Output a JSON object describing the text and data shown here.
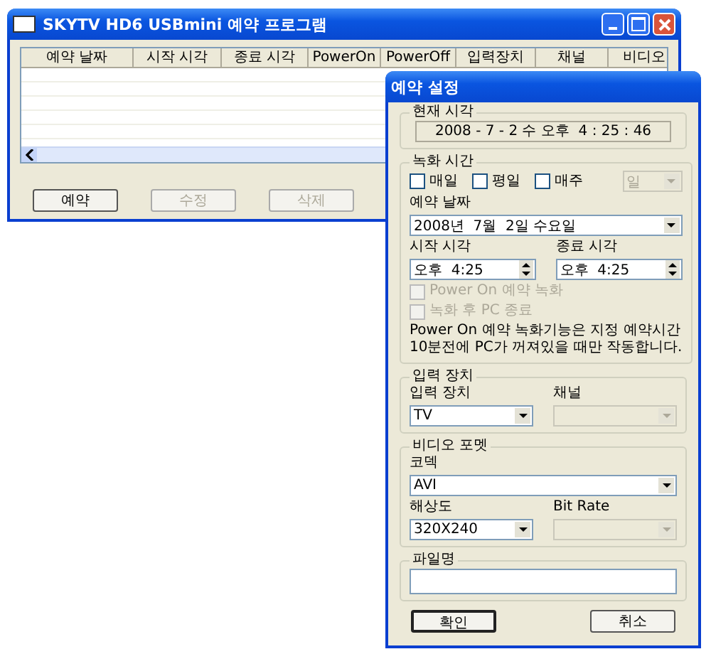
{
  "main_window": {
    "title": "SKYTV HD6 USBmini 예약 프로그램",
    "table": {
      "columns": [
        "예약 날짜",
        "시작 시각",
        "종료 시각",
        "PowerOn",
        "PowerOff",
        "입력장치",
        "채널",
        "비디오"
      ]
    },
    "buttons": [
      {
        "label": "예약",
        "disabled": false
      },
      {
        "label": "수정",
        "disabled": true
      },
      {
        "label": "삭제",
        "disabled": true
      }
    ]
  },
  "dialog": {
    "title": "예약 설정",
    "current_time": {
      "legend": "현재 시각",
      "value": "2008 - 7 - 2 수 오후  4 : 25 : 46"
    },
    "recording_time": {
      "legend": "녹화 시간",
      "repeat": [
        {
          "label": "매일",
          "checked": false
        },
        {
          "label": "평일",
          "checked": false
        },
        {
          "label": "매주",
          "checked": false
        }
      ],
      "weekday": {
        "value": "일",
        "disabled": true
      },
      "date_label": "예약 날짜",
      "date": {
        "value": "2008년  7월  2일 수요일",
        "disabled": false
      },
      "start_label": "시작 시각",
      "start_value": "오후  4:25",
      "end_label": "종료 시각",
      "end_value": "오후  4:25",
      "options": [
        {
          "label": "Power On 예약 녹화",
          "checked": false,
          "disabled": true
        },
        {
          "label": "녹화 후 PC 종료",
          "checked": false,
          "disabled": true
        }
      ],
      "note": [
        "Power On 예약 녹화기능은 지정 예약시간",
        "10분전에 PC가 꺼져있을 때만 작동합니다."
      ]
    },
    "input_device": {
      "legend": "입력 장치",
      "device_label": "입력 장치",
      "device": {
        "value": "TV",
        "disabled": false
      },
      "channel_label": "채널",
      "channel": {
        "disabled": true
      }
    },
    "video_format": {
      "legend": "비디오 포멧",
      "codec_label": "코덱",
      "codec": {
        "value": "AVI",
        "disabled": false
      },
      "resolution_label": "해상도",
      "resolution": {
        "value": "320X240",
        "disabled": false
      },
      "bitrate_label": "Bit Rate",
      "bitrate": {
        "disabled": true
      }
    },
    "filename": {
      "legend": "파일명"
    },
    "buttons": [
      {
        "label": "확인",
        "default": true
      },
      {
        "label": "취소",
        "default": false
      }
    ]
  }
}
